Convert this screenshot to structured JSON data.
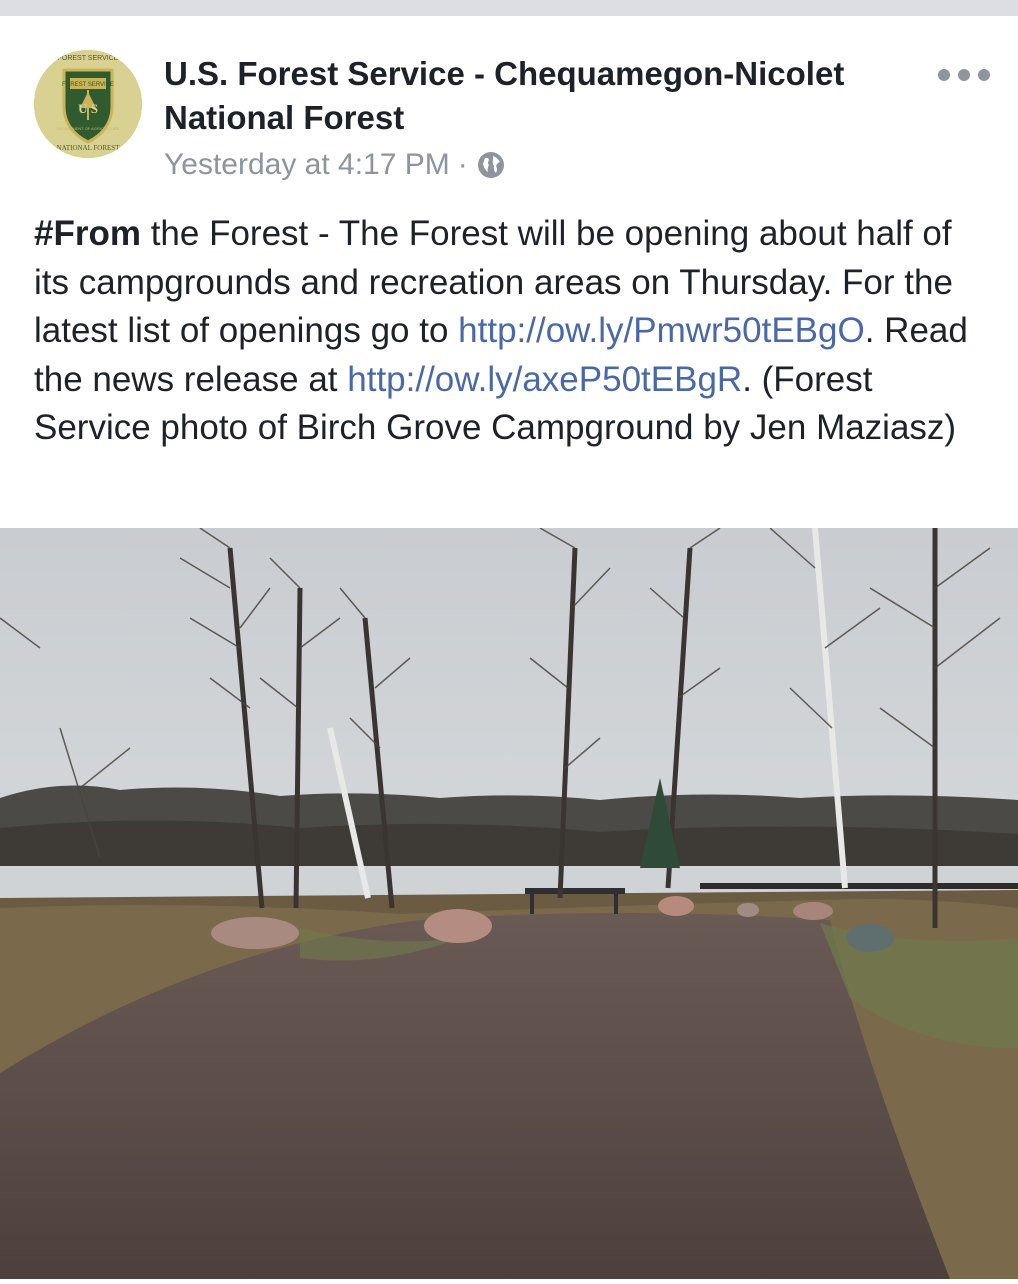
{
  "post": {
    "page_name": "U.S. Forest Service - Chequamegon-Nicolet National Forest",
    "timestamp": "Yesterday at 4:17 PM",
    "separator": "·",
    "privacy_icon": "globe-icon",
    "more_icon": "more-options-icon",
    "avatar_logo": {
      "top_arc": "FOREST SERVICE",
      "shield_text": "U S",
      "shield_caption": "FOREST SERVICE",
      "bottom_text": "DEPARTMENT OF AGRICULTURE",
      "footer": "NATIONAL FOREST"
    },
    "text": {
      "hashtag": "#From",
      "part1": " the Forest - The Forest will be opening about half of its campgrounds and recreation areas on Thursday. For the latest list of openings go to ",
      "link1": "http://ow.ly/Pmwr50tEBgO",
      "part2": ". Read the news release at ",
      "link2": "http://ow.ly/axeP50tEBgR",
      "part3": ". (Forest Service photo of Birch Grove Campground by Jen Maziasz)"
    },
    "photo_subject": "campground-lake-photo"
  },
  "colors": {
    "link": "#4b68a6",
    "text": "#1d2129",
    "meta": "#8d949e",
    "shield_green": "#2f5b2e",
    "shield_gold": "#c9b45a"
  }
}
